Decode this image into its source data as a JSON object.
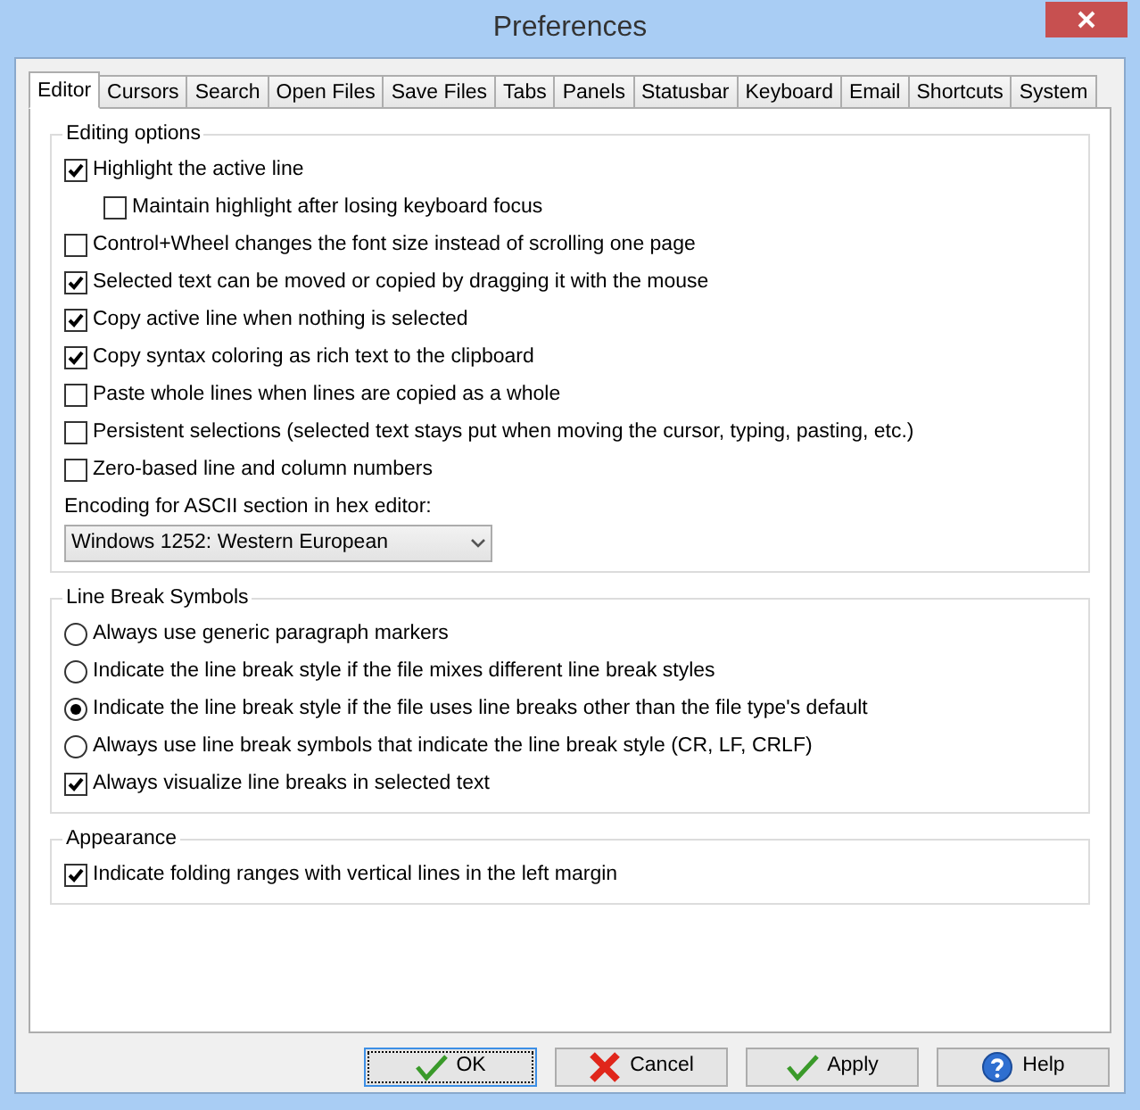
{
  "window": {
    "title": "Preferences"
  },
  "tabs": [
    {
      "label": "Editor",
      "selected": true
    },
    {
      "label": "Cursors",
      "selected": false
    },
    {
      "label": "Search",
      "selected": false
    },
    {
      "label": "Open Files",
      "selected": false
    },
    {
      "label": "Save Files",
      "selected": false
    },
    {
      "label": "Tabs",
      "selected": false
    },
    {
      "label": "Panels",
      "selected": false
    },
    {
      "label": "Statusbar",
      "selected": false
    },
    {
      "label": "Keyboard",
      "selected": false
    },
    {
      "label": "Email",
      "selected": false
    },
    {
      "label": "Shortcuts",
      "selected": false
    },
    {
      "label": "System",
      "selected": false
    }
  ],
  "groups": [
    {
      "title": "Editing options",
      "items": [
        {
          "kind": "checkbox",
          "label": "Highlight the active line",
          "checked": true,
          "children": [
            {
              "kind": "checkbox",
              "label": "Maintain highlight after losing keyboard focus",
              "checked": false
            }
          ]
        },
        {
          "kind": "checkbox",
          "label": "Control+Wheel changes the font size instead of scrolling one page",
          "checked": false
        },
        {
          "kind": "checkbox",
          "label": "Selected text can be moved or copied by dragging it with the mouse",
          "checked": true
        },
        {
          "kind": "checkbox",
          "label": "Copy active line when nothing is selected",
          "checked": true
        },
        {
          "kind": "checkbox",
          "label": "Copy syntax coloring as rich text to the clipboard",
          "checked": true
        },
        {
          "kind": "checkbox",
          "label": "Paste whole lines when lines are copied as a whole",
          "checked": false
        },
        {
          "kind": "checkbox",
          "label": "Persistent selections (selected text stays put when moving the cursor, typing, pasting, etc.)",
          "checked": false
        },
        {
          "kind": "checkbox",
          "label": "Zero-based line and column numbers",
          "checked": false
        },
        {
          "kind": "select",
          "label": "Encoding for ASCII section in hex editor:",
          "value": "Windows 1252: Western European"
        }
      ]
    },
    {
      "title": "Line Break Symbols",
      "items": [
        {
          "kind": "radio",
          "label": "Always use generic paragraph markers",
          "selected": false
        },
        {
          "kind": "radio",
          "label": "Indicate the line break style if the file mixes different line break styles",
          "selected": false
        },
        {
          "kind": "radio",
          "label": "Indicate the line break style if the file uses line breaks other than the file type's default",
          "selected": true
        },
        {
          "kind": "radio",
          "label": "Always use line break symbols that indicate the line break style (CR, LF, CRLF)",
          "selected": false
        },
        {
          "kind": "checkbox",
          "label": "Always visualize line breaks in selected text",
          "checked": true
        }
      ]
    },
    {
      "title": "Appearance",
      "items": [
        {
          "kind": "checkbox",
          "label": "Indicate folding ranges with vertical lines in the left margin",
          "checked": true
        }
      ]
    }
  ],
  "buttons": [
    {
      "kind": "confirm",
      "label": "OK",
      "focused": true
    },
    {
      "kind": "cancel",
      "label": "Cancel",
      "focused": false
    },
    {
      "kind": "confirm",
      "label": "Apply",
      "focused": false
    },
    {
      "kind": "help",
      "label": "Help",
      "focused": false
    }
  ]
}
